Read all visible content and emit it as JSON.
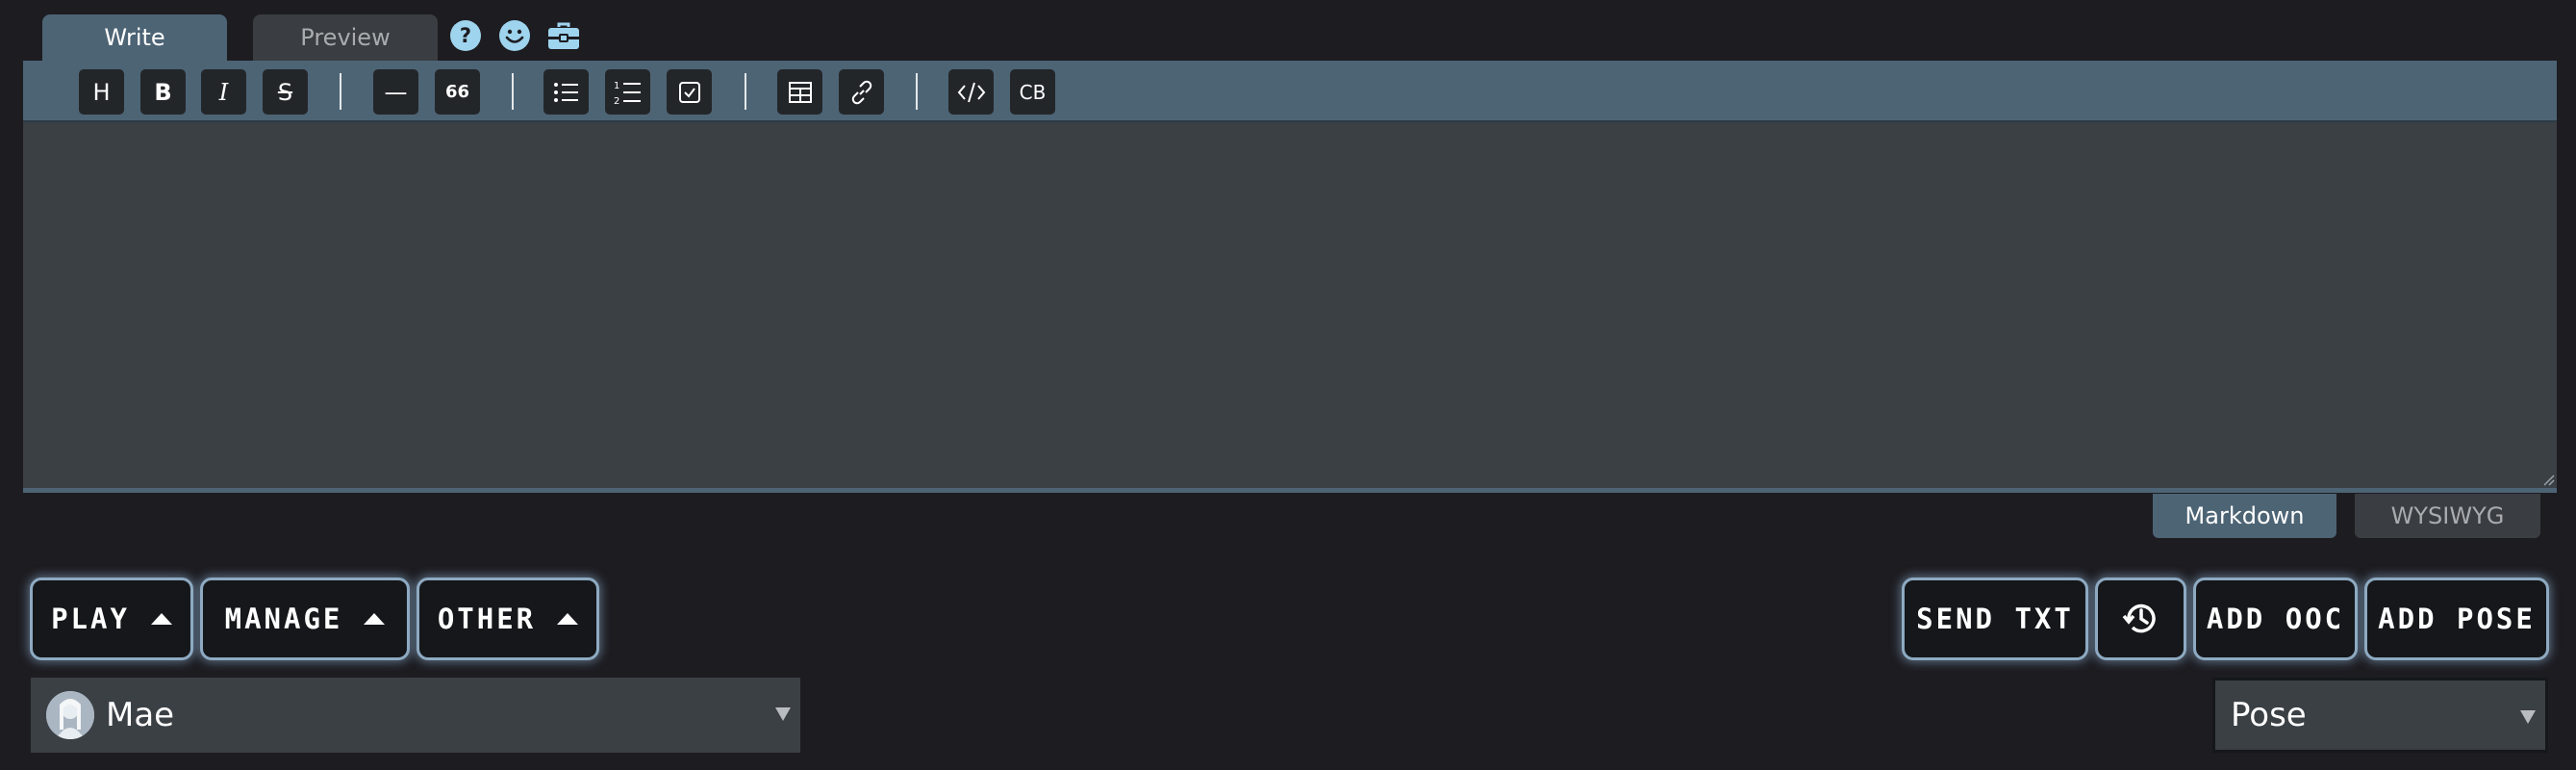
{
  "tabs": {
    "write": "Write",
    "preview": "Preview"
  },
  "top_icons": [
    "help-icon",
    "emoji-icon",
    "toolbox-icon"
  ],
  "toolbar": {
    "heading": "H",
    "bold": "B",
    "italic": "I",
    "strike": "S",
    "horizontal_rule": "—",
    "quote": "66",
    "code_block": "CB"
  },
  "editor": {
    "value": "",
    "placeholder": ""
  },
  "modes": {
    "markdown": "Markdown",
    "wysiwyg": "WYSIWYG"
  },
  "actions": {
    "play": "PLAY",
    "manage": "MANAGE",
    "other": "OTHER",
    "send_txt": "SEND TXT",
    "add_ooc": "ADD OOC",
    "add_pose": "ADD POSE"
  },
  "character_select": {
    "selected": "Mae"
  },
  "pose_select": {
    "selected": "Pose"
  },
  "colors": {
    "background": "#1d1c21",
    "accent": "#4d6475",
    "editor": "#3b4045",
    "button_glow": "#8eaac2"
  }
}
